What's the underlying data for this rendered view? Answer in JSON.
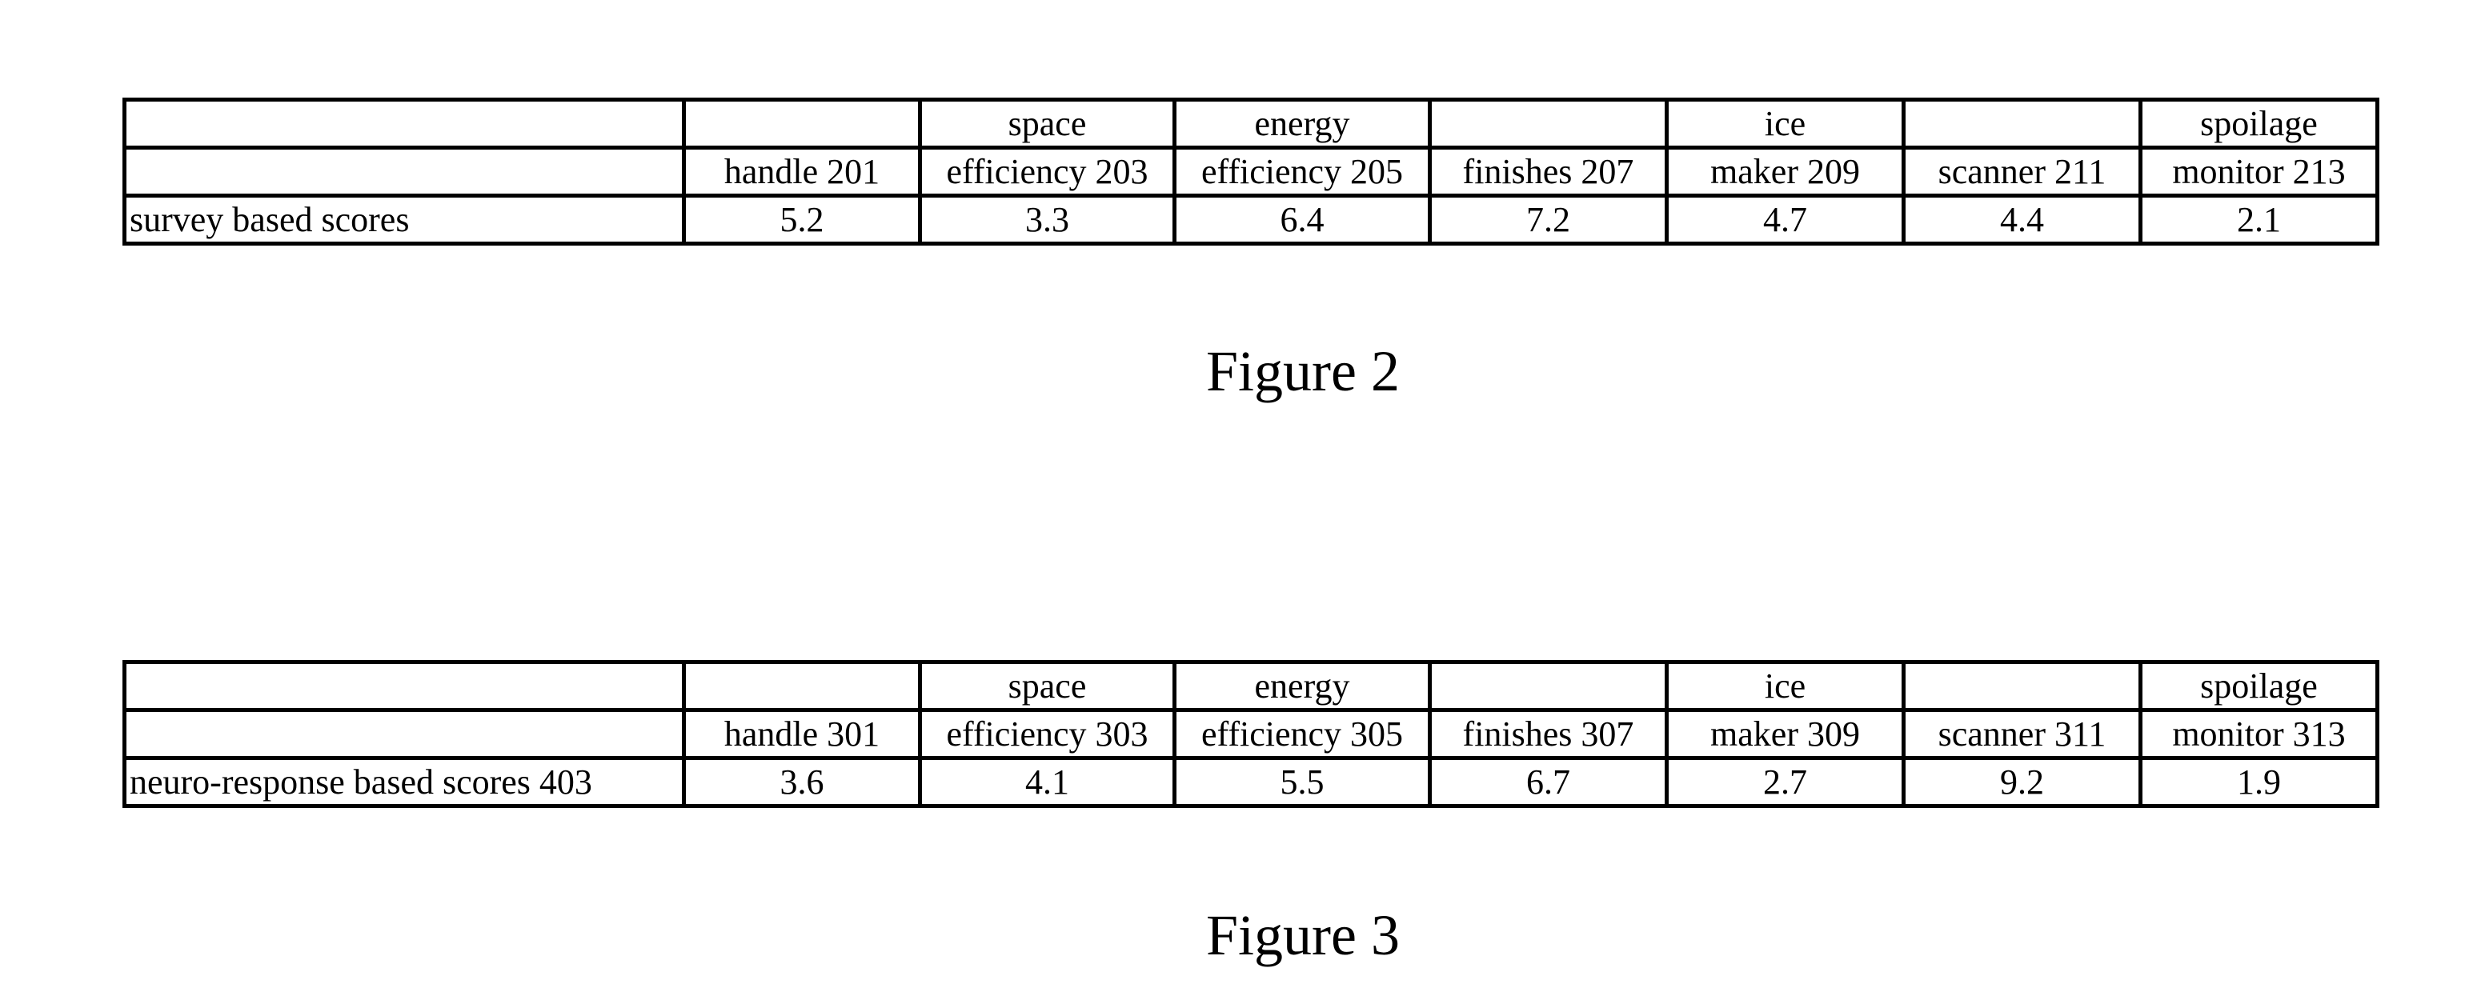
{
  "figures": [
    {
      "caption": "Figure 2",
      "header_row1": [
        "",
        "",
        "space",
        "energy",
        "",
        "ice",
        "",
        "spoilage"
      ],
      "header_row2": [
        "",
        "handle 201",
        "efficiency 203",
        "efficiency 205",
        "finishes 207",
        "maker 209",
        "scanner 211",
        "monitor 213"
      ],
      "data_row": [
        "survey based scores",
        "5.2",
        "3.3",
        "6.4",
        "7.2",
        "4.7",
        "4.4",
        "2.1"
      ]
    },
    {
      "caption": "Figure 3",
      "header_row1": [
        "",
        "",
        "space",
        "energy",
        "",
        "ice",
        "",
        "spoilage"
      ],
      "header_row2": [
        "",
        "handle 301",
        "efficiency 303",
        "efficiency 305",
        "finishes 307",
        "maker 309",
        "scanner 311",
        "monitor 313"
      ],
      "data_row": [
        "neuro-response based scores 403",
        "3.6",
        "4.1",
        "5.5",
        "6.7",
        "2.7",
        "9.2",
        "1.9"
      ]
    }
  ],
  "chart_data": [
    {
      "type": "table",
      "title": "Figure 2",
      "columns": [
        "",
        "handle 201",
        "space efficiency 203",
        "energy efficiency 205",
        "finishes 207",
        "ice maker 209",
        "scanner 211",
        "spoilage monitor 213"
      ],
      "rows": [
        [
          "survey based scores",
          5.2,
          3.3,
          6.4,
          7.2,
          4.7,
          4.4,
          2.1
        ]
      ]
    },
    {
      "type": "table",
      "title": "Figure 3",
      "columns": [
        "",
        "handle 301",
        "space efficiency 303",
        "energy efficiency 305",
        "finishes 307",
        "ice maker 309",
        "scanner 311",
        "spoilage monitor 313"
      ],
      "rows": [
        [
          "neuro-response based scores 403",
          3.6,
          4.1,
          5.5,
          6.7,
          2.7,
          9.2,
          1.9
        ]
      ]
    }
  ]
}
